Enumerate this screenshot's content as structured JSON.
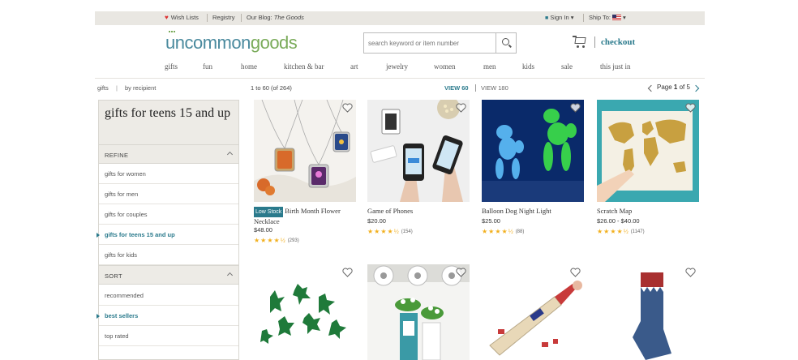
{
  "utility_bar": {
    "wish_lists": "Wish Lists",
    "registry": "Registry",
    "blog_prefix": "Our Blog:",
    "blog_name": "The Goods",
    "sign_in": "Sign In",
    "ship_to": "Ship To:"
  },
  "header": {
    "logo_part1": "uncommon",
    "logo_part2": "goods",
    "search_placeholder": "search keyword or item number",
    "checkout": "checkout"
  },
  "nav": [
    "gifts",
    "fun",
    "home",
    "kitchen & bar",
    "art",
    "jewelry",
    "women",
    "men",
    "kids",
    "sale",
    "this just in"
  ],
  "breadcrumb": {
    "root": "gifts",
    "sep": "|",
    "current": "by recipient"
  },
  "listing": {
    "results": "1 to 60 (of 264)",
    "view60": "VIEW 60",
    "view180": "VIEW 180",
    "page_label": "Page",
    "page_current": "1",
    "page_of": "of 5"
  },
  "sidebar": {
    "title": "gifts for teens 15 and up",
    "refine_label": "REFINE",
    "refine_items": [
      {
        "label": "gifts for women",
        "active": false
      },
      {
        "label": "gifts for men",
        "active": false
      },
      {
        "label": "gifts for couples",
        "active": false
      },
      {
        "label": "gifts for teens 15 and up",
        "active": true
      },
      {
        "label": "gifts for kids",
        "active": false
      }
    ],
    "sort_label": "SORT",
    "sort_items": [
      {
        "label": "recommended",
        "active": false
      },
      {
        "label": "best sellers",
        "active": true
      },
      {
        "label": "top rated",
        "active": false
      }
    ]
  },
  "products": [
    {
      "badge": "Low Stock",
      "title": "Birth Month Flower Necklace",
      "price": "$48.00",
      "stars": 4.5,
      "reviews": "(293)"
    },
    {
      "badge": "",
      "title": "Game of Phones",
      "price": "$20.00",
      "stars": 4.5,
      "reviews": "(154)"
    },
    {
      "badge": "",
      "title": "Balloon Dog Night Light",
      "price": "$25.00",
      "stars": 4.5,
      "reviews": "(88)"
    },
    {
      "badge": "",
      "title": "Scratch Map",
      "price": "$26.00 - $40.00",
      "stars": 4.5,
      "reviews": "(1147)"
    }
  ],
  "colors": {
    "accent": "#2a7a8c",
    "logo_blue": "#4a8a9e",
    "logo_green": "#7aab5a",
    "star": "#f2b01e",
    "utility_bg": "#e9e7e2"
  }
}
